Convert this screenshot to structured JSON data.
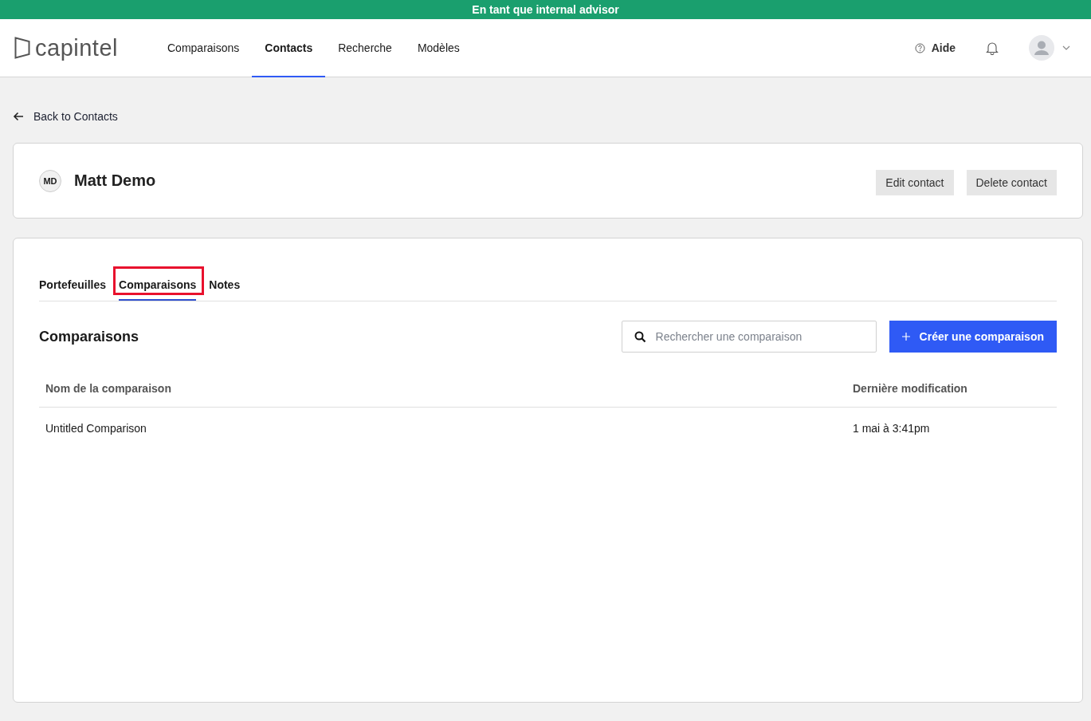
{
  "banner": {
    "text": "En tant que internal advisor"
  },
  "header": {
    "logo": "capintel",
    "nav": [
      {
        "label": "Comparaisons",
        "selected": false
      },
      {
        "label": "Contacts",
        "selected": true
      },
      {
        "label": "Recherche",
        "selected": false
      },
      {
        "label": "Modèles",
        "selected": false
      }
    ],
    "help": "Aide"
  },
  "back_link": "Back to Contacts",
  "contact": {
    "initials": "MD",
    "name": "Matt Demo",
    "buttons": [
      "Edit contact",
      "Delete contact"
    ]
  },
  "tabs": [
    {
      "label": "Portefeuilles",
      "selected": false,
      "highlighted": false
    },
    {
      "label": "Comparaisons",
      "selected": true,
      "highlighted": true
    },
    {
      "label": "Notes",
      "selected": false,
      "highlighted": false
    }
  ],
  "section": {
    "title": "Comparaisons",
    "search": {
      "placeholder": "Rechercher une comparaison"
    },
    "create_button": "Créer une comparaison"
  },
  "table": {
    "columns": [
      "Nom de la comparaison",
      "Dernière modification"
    ],
    "rows": [
      [
        "Untitled Comparison",
        "1 mai à 3:41pm"
      ]
    ]
  }
}
